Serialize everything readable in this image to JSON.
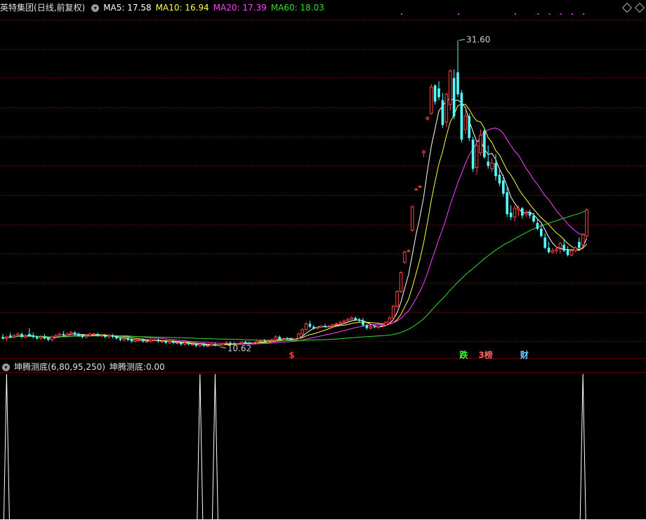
{
  "header": {
    "stock": "英特集团",
    "period": "(日线,前复权)",
    "ma": [
      {
        "label": "MA5:",
        "value": "17.58",
        "color": "#ffffff"
      },
      {
        "label": "MA10:",
        "value": "16.94",
        "color": "#ffff44"
      },
      {
        "label": "MA20:",
        "value": "17.39",
        "color": "#ff44ff"
      },
      {
        "label": "MA60:",
        "value": "18.03",
        "color": "#33dd33"
      }
    ]
  },
  "indicator": {
    "name": "坤腾测底",
    "params": "(6,80,95,250)",
    "value_label": "坤腾测底:",
    "value": "0.00"
  },
  "chart_data": [
    {
      "type": "candlestick",
      "name": "daily-k",
      "up_color": "#ff4444",
      "down_color": "#54ffff",
      "ylim": [
        10.2,
        33.2
      ],
      "y_gridlines": [
        11,
        13,
        15,
        17,
        19,
        21,
        23,
        25,
        27,
        29,
        31,
        33
      ],
      "annotations": [
        {
          "text": "31.60",
          "at_index": 120,
          "price": 31.6
        },
        {
          "text": "10.62",
          "at_index": 57,
          "price": 10.62
        }
      ],
      "markers": [
        {
          "text": "$",
          "at_index": 76,
          "color": "#ff3333"
        },
        {
          "text": "跌",
          "at_index": 121,
          "color": "#33ff33"
        },
        {
          "text": "3榜",
          "at_index": 126,
          "color": "#ff6666"
        },
        {
          "text": "财",
          "at_index": 137,
          "color": "#66ccff"
        }
      ],
      "candles": [
        [
          11.3,
          11.5,
          11.1,
          11.2
        ],
        [
          11.2,
          11.4,
          11.0,
          11.3
        ],
        [
          11.4,
          11.6,
          11.2,
          11.3
        ],
        [
          11.3,
          11.5,
          11.2,
          11.4
        ],
        [
          11.4,
          11.6,
          11.3,
          11.5
        ],
        [
          11.5,
          11.6,
          11.2,
          11.3
        ],
        [
          11.3,
          11.5,
          11.2,
          11.4
        ],
        [
          11.5,
          11.9,
          11.3,
          11.4
        ],
        [
          11.4,
          11.6,
          11.2,
          11.3
        ],
        [
          11.3,
          11.4,
          11.1,
          11.2
        ],
        [
          11.2,
          11.4,
          11.1,
          11.3
        ],
        [
          11.3,
          11.5,
          11.1,
          11.2
        ],
        [
          11.2,
          11.3,
          11.0,
          11.1
        ],
        [
          11.1,
          11.4,
          11.0,
          11.3
        ],
        [
          11.3,
          11.5,
          11.2,
          11.4
        ],
        [
          11.4,
          11.6,
          11.3,
          11.5
        ],
        [
          11.5,
          11.7,
          11.3,
          11.4
        ],
        [
          11.4,
          11.6,
          11.3,
          11.5
        ],
        [
          11.5,
          11.7,
          11.4,
          11.6
        ],
        [
          11.6,
          11.7,
          11.4,
          11.5
        ],
        [
          11.5,
          11.6,
          11.3,
          11.4
        ],
        [
          11.4,
          11.5,
          11.2,
          11.3
        ],
        [
          11.3,
          11.5,
          11.2,
          11.4
        ],
        [
          11.4,
          11.6,
          11.3,
          11.5
        ],
        [
          11.5,
          11.6,
          11.4,
          11.5
        ],
        [
          11.5,
          11.6,
          11.3,
          11.4
        ],
        [
          11.4,
          11.5,
          11.3,
          11.4
        ],
        [
          11.4,
          11.5,
          11.2,
          11.3
        ],
        [
          11.3,
          11.5,
          11.2,
          11.4
        ],
        [
          11.4,
          11.5,
          11.2,
          11.3
        ],
        [
          11.3,
          11.4,
          11.1,
          11.2
        ],
        [
          11.2,
          11.3,
          11.0,
          11.1
        ],
        [
          11.1,
          11.3,
          11.0,
          11.2
        ],
        [
          11.2,
          11.3,
          11.0,
          11.1
        ],
        [
          11.1,
          11.2,
          10.9,
          11.0
        ],
        [
          11.0,
          11.2,
          10.9,
          11.1
        ],
        [
          11.1,
          11.2,
          11.0,
          11.1
        ],
        [
          11.1,
          11.2,
          10.9,
          11.0
        ],
        [
          11.0,
          11.1,
          10.9,
          11.0
        ],
        [
          11.0,
          11.2,
          10.9,
          11.1
        ],
        [
          11.1,
          11.2,
          11.0,
          11.1
        ],
        [
          11.1,
          11.2,
          10.9,
          11.0
        ],
        [
          11.0,
          11.1,
          10.9,
          11.0
        ],
        [
          11.0,
          11.1,
          10.8,
          10.9
        ],
        [
          10.9,
          11.1,
          10.8,
          11.0
        ],
        [
          11.0,
          11.1,
          10.8,
          10.9
        ],
        [
          10.9,
          11.0,
          10.8,
          10.9
        ],
        [
          10.9,
          11.0,
          10.7,
          10.8
        ],
        [
          10.8,
          11.0,
          10.7,
          10.9
        ],
        [
          10.9,
          11.0,
          10.7,
          10.8
        ],
        [
          10.8,
          10.9,
          10.7,
          10.8
        ],
        [
          10.8,
          10.9,
          10.6,
          10.7
        ],
        [
          10.7,
          10.9,
          10.6,
          10.8
        ],
        [
          10.8,
          10.9,
          10.6,
          10.7
        ],
        [
          10.7,
          10.8,
          10.6,
          10.7
        ],
        [
          10.7,
          10.9,
          10.65,
          10.8
        ],
        [
          10.8,
          10.9,
          10.65,
          10.7
        ],
        [
          10.7,
          10.8,
          10.62,
          10.75
        ],
        [
          10.75,
          10.9,
          10.7,
          10.85
        ],
        [
          10.85,
          11.0,
          10.8,
          10.9
        ],
        [
          10.9,
          11.0,
          10.8,
          10.85
        ],
        [
          10.85,
          10.95,
          10.75,
          10.8
        ],
        [
          10.8,
          10.9,
          10.7,
          10.85
        ],
        [
          10.85,
          11.0,
          10.8,
          10.95
        ],
        [
          10.95,
          11.05,
          10.85,
          10.9
        ],
        [
          10.9,
          11.0,
          10.8,
          10.85
        ],
        [
          10.85,
          10.95,
          10.75,
          10.9
        ],
        [
          10.9,
          11.05,
          10.85,
          11.0
        ],
        [
          11.0,
          11.1,
          10.9,
          11.05
        ],
        [
          11.05,
          11.15,
          10.95,
          11.0
        ],
        [
          11.0,
          11.1,
          10.9,
          11.05
        ],
        [
          11.05,
          11.2,
          11.0,
          11.1
        ],
        [
          11.1,
          11.4,
          11.05,
          11.3
        ],
        [
          11.3,
          11.4,
          11.1,
          11.15
        ],
        [
          11.15,
          11.25,
          11.05,
          11.2
        ],
        [
          11.2,
          11.3,
          11.1,
          11.15
        ],
        [
          11.15,
          11.25,
          11.05,
          11.1
        ],
        [
          11.1,
          11.2,
          11.0,
          11.15
        ],
        [
          11.2,
          11.6,
          11.15,
          11.5
        ],
        [
          11.5,
          11.9,
          11.4,
          11.8
        ],
        [
          11.8,
          12.3,
          11.7,
          12.2
        ],
        [
          12.2,
          12.4,
          11.9,
          12.0
        ],
        [
          12.0,
          12.1,
          11.8,
          11.9
        ],
        [
          11.9,
          12.0,
          11.8,
          11.95
        ],
        [
          11.95,
          12.1,
          11.9,
          12.05
        ],
        [
          12.05,
          12.2,
          11.95,
          12.0
        ],
        [
          12.0,
          12.1,
          11.9,
          12.05
        ],
        [
          12.05,
          12.2,
          12.0,
          12.15
        ],
        [
          12.15,
          12.3,
          12.1,
          12.2
        ],
        [
          12.2,
          12.4,
          12.1,
          12.3
        ],
        [
          12.3,
          12.5,
          12.2,
          12.4
        ],
        [
          12.4,
          12.6,
          12.3,
          12.5
        ],
        [
          12.5,
          12.7,
          12.4,
          12.6
        ],
        [
          12.6,
          12.7,
          12.4,
          12.45
        ],
        [
          12.45,
          12.6,
          12.3,
          12.4
        ],
        [
          12.4,
          12.6,
          12.0,
          12.1
        ],
        [
          12.1,
          12.2,
          11.8,
          11.9
        ],
        [
          11.9,
          12.1,
          11.8,
          12.0
        ],
        [
          12.0,
          12.1,
          11.9,
          11.95
        ],
        [
          11.95,
          12.1,
          11.85,
          12.05
        ],
        [
          12.05,
          12.2,
          12.0,
          12.1
        ],
        [
          12.1,
          12.4,
          12.0,
          12.3
        ],
        [
          12.3,
          12.7,
          12.2,
          12.6
        ],
        [
          12.6,
          13.5,
          12.5,
          13.4
        ],
        [
          13.4,
          14.5,
          13.3,
          14.4
        ],
        [
          14.4,
          15.8,
          14.3,
          15.7
        ],
        [
          16.4,
          17.2,
          16.3,
          17.1
        ],
        [
          17.2,
          17.3,
          17.1,
          17.2
        ],
        [
          18.6,
          20.3,
          18.5,
          20.2
        ],
        [
          21.4,
          21.5,
          21.35,
          21.4
        ],
        [
          21.6,
          21.7,
          21.5,
          21.6
        ],
        [
          23.9,
          24.1,
          23.6,
          24.0
        ],
        [
          26.2,
          26.4,
          26.1,
          26.3
        ],
        [
          26.6,
          28.6,
          26.5,
          28.4
        ],
        [
          28.5,
          28.6,
          27.2,
          27.4
        ],
        [
          28.3,
          28.8,
          27.5,
          27.7
        ],
        [
          27.5,
          28.0,
          25.6,
          25.8
        ],
        [
          26.0,
          28.0,
          25.7,
          27.9
        ],
        [
          27.2,
          29.6,
          26.8,
          29.5
        ],
        [
          29.0,
          29.6,
          26.2,
          26.4
        ],
        [
          29.4,
          31.6,
          27.7,
          27.9
        ],
        [
          28.0,
          28.2,
          24.6,
          24.8
        ],
        [
          25.5,
          26.8,
          25.2,
          26.4
        ],
        [
          26.4,
          26.6,
          24.7,
          24.9
        ],
        [
          24.8,
          25.0,
          22.6,
          22.8
        ],
        [
          22.9,
          24.6,
          22.4,
          24.4
        ],
        [
          23.9,
          25.5,
          23.7,
          25.1
        ],
        [
          25.4,
          25.5,
          23.5,
          23.6
        ],
        [
          23.3,
          24.4,
          22.8,
          23.0
        ],
        [
          22.8,
          23.5,
          22.6,
          23.2
        ],
        [
          23.2,
          23.8,
          22.0,
          22.3
        ],
        [
          22.4,
          22.8,
          21.6,
          21.8
        ],
        [
          22.0,
          22.4,
          20.9,
          21.1
        ],
        [
          21.2,
          21.6,
          19.5,
          19.7
        ],
        [
          19.8,
          20.3,
          19.3,
          19.5
        ],
        [
          19.5,
          20.3,
          19.2,
          20.1
        ],
        [
          20.0,
          20.3,
          19.6,
          20.1
        ],
        [
          20.1,
          20.2,
          19.4,
          19.6
        ],
        [
          19.7,
          20.0,
          19.5,
          19.8
        ],
        [
          19.8,
          20.0,
          19.4,
          19.6
        ],
        [
          19.6,
          19.8,
          19.1,
          19.2
        ],
        [
          19.1,
          19.4,
          18.6,
          18.7
        ],
        [
          18.7,
          19.0,
          18.1,
          18.2
        ],
        [
          18.1,
          18.4,
          17.3,
          17.4
        ],
        [
          17.4,
          17.8,
          17.0,
          17.1
        ],
        [
          17.1,
          17.4,
          17.0,
          17.2
        ],
        [
          17.2,
          17.5,
          17.0,
          17.3
        ],
        [
          17.4,
          17.8,
          17.0,
          17.7
        ],
        [
          17.6,
          18.0,
          17.1,
          17.2
        ],
        [
          17.3,
          17.5,
          16.8,
          16.9
        ],
        [
          16.9,
          17.3,
          16.8,
          17.2
        ],
        [
          17.2,
          17.5,
          17.1,
          17.4
        ],
        [
          17.8,
          18.1,
          17.2,
          17.4
        ],
        [
          17.6,
          18.4,
          17.4,
          18.3
        ],
        [
          18.2,
          20.1,
          18.1,
          20.0
        ]
      ]
    },
    {
      "type": "line",
      "name": "坤腾测底",
      "ylim": [
        0,
        100
      ],
      "x_count": 167,
      "spikes": [
        {
          "index": 1,
          "value": 100
        },
        {
          "index": 52,
          "value": 100
        },
        {
          "index": 56,
          "value": 100
        },
        {
          "index": 153,
          "value": 100
        }
      ]
    }
  ]
}
